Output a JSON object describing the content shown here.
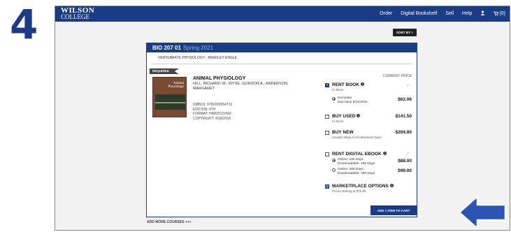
{
  "step_number": "4",
  "header": {
    "logo_line1": "WILSON",
    "logo_line2": "COLLEGE",
    "nav": [
      "Order",
      "Digital Bookshelf",
      "Sell",
      "Help"
    ],
    "cart_label": "(0)"
  },
  "sort_label": "SORT BY ˅",
  "course": {
    "code": "BIO 207 01",
    "term": "Spring 2021",
    "subtitle": "VERTEBRATE PHYSIOLOGY - BRADLEY ENGLE"
  },
  "required_tag": "REQUIRED",
  "book": {
    "cover_title_1": "Animal",
    "cover_title_2": "Physiology",
    "title": "ANIMAL PHYSIOLOGY",
    "authors": "HILL, RICHARD W.; WYSE, GORDON A.; ANDERSON, MARGARET",
    "isbn": "ISBN13: 9781605354712",
    "edition": "EDITION: 4TH",
    "format": "FORMAT: HARDCOVER",
    "copyright": "COPYRIGHT: 4/18/2016"
  },
  "current_price_label": "CURRENT PRICE",
  "options": {
    "rent": {
      "title": "RENT BOOK",
      "sub": "In Stock",
      "radio_label": "Semester",
      "radio_sub": "Due back 5/21/2021",
      "price": "$62.06"
    },
    "used": {
      "title": "BUY USED",
      "sub": "In Stock",
      "price": "$141.50"
    },
    "new": {
      "title": "BUY NEW",
      "sub": "Usually Ships in 3-5 Business Days",
      "price": "$204.80"
    },
    "digital": {
      "title": "RENT DIGITAL EBOOK",
      "r1_label": "Online: 180 Days",
      "r1_sub": "Downloadable: 180 Days",
      "r1_price": "$88.00",
      "r2_label": "Online: 365 Days",
      "r2_sub": "Downloadable: 365 Days",
      "r2_price": "$99.00"
    },
    "marketplace": {
      "title": "MARKETPLACE OPTIONS",
      "sub": "Prices starting at $76.80"
    }
  },
  "add_button": "ADD 1 ITEM TO CART",
  "add_more_courses": "ADD MORE COURSES +++",
  "colors": {
    "brand": "#1a3c86",
    "arrow": "#2a55b5"
  }
}
